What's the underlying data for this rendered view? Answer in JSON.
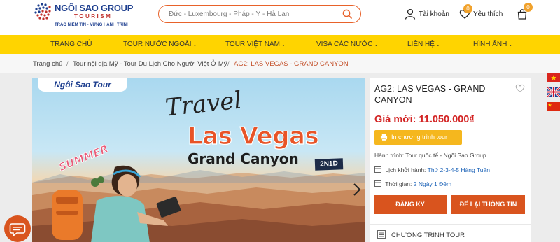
{
  "brand": {
    "name": "NGÔI SAO GROUP",
    "sub": "TOURISM",
    "tagline": "TRAO NIỀM TIN - VỮNG HÀNH TRÌNH"
  },
  "search": {
    "placeholder": "Đức - Luxembourg - Pháp - Ý - Hà Lan"
  },
  "header": {
    "account_label": "Tài khoản",
    "wishlist_label": "Yêu thích",
    "wishlist_count": "0",
    "cart_count": "0"
  },
  "nav": {
    "items": [
      {
        "label": "TRANG CHỦ"
      },
      {
        "label": "TOUR NƯỚC NGOÀI"
      },
      {
        "label": "TOUR VIỆT NAM"
      },
      {
        "label": "VISA CÁC NƯỚC"
      },
      {
        "label": "LIÊN HỆ"
      },
      {
        "label": "HÌNH ẢNH"
      }
    ]
  },
  "breadcrumb": {
    "items": [
      {
        "label": "Trang chủ"
      },
      {
        "label": "Tour nội địa Mỹ - Tour Du Lịch Cho Người Việt Ở Mỹ"
      },
      {
        "label": "AG2: LAS VEGAS - GRAND CANYON"
      }
    ]
  },
  "hero": {
    "brand_pill": "Ngôi Sao Tour",
    "travel": "Travel",
    "city": "Las Vegas",
    "subtitle": "Grand Canyon",
    "days": "2N1D",
    "summer": "SUMMER"
  },
  "product": {
    "title": "AG2: LAS VEGAS - GRAND CANYON",
    "price": "Giá mới: 11.050.000₫",
    "promo_label": "In chương trình tour",
    "itinerary_label": "Hành trình:",
    "itinerary_value": "Tour quốc tế - Ngôi Sao Group",
    "schedule_label": "Lịch khởi hành:",
    "schedule_value": "Thứ 2-3-4-5 Hàng Tuần",
    "duration_label": "Thời gian:",
    "duration_value": "2 Ngày 1 Đêm",
    "book_label": "ĐĂNG KÝ",
    "contact_label": "ĐỂ LẠI THÔNG TIN",
    "program_label": "CHƯƠNG TRÌNH TOUR"
  },
  "colors": {
    "accent": "#d9541e",
    "nav_bg": "#ffd400",
    "price": "#d32424",
    "promo": "#f5b71e",
    "link": "#1e64b8"
  },
  "icons": [
    "globe-logo-icon",
    "search-icon",
    "user-icon",
    "heart-icon",
    "cart-icon",
    "chevron-down-icon",
    "chevron-right-icon",
    "print-icon",
    "map-icon",
    "calendar-icon",
    "clock-icon",
    "list-icon",
    "chat-icon",
    "flag-vn-icon",
    "flag-uk-icon",
    "flag-cn-icon"
  ]
}
